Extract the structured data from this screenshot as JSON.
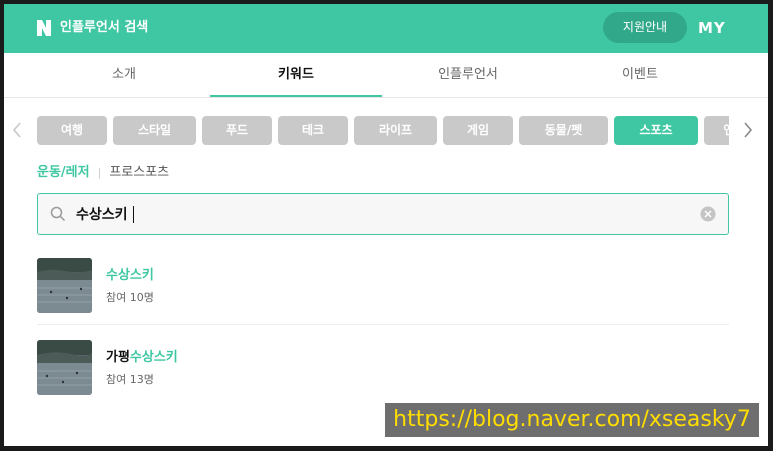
{
  "header": {
    "title": "인플루언서 검색",
    "support_label": "지원안내",
    "my_label": "MY",
    "brand_color": "#3fc7a3"
  },
  "tabs": [
    {
      "label": "소개",
      "active": false
    },
    {
      "label": "키워드",
      "active": true
    },
    {
      "label": "인플루언서",
      "active": false
    },
    {
      "label": "이벤트",
      "active": false
    }
  ],
  "categories": [
    {
      "label": "여행",
      "active": false
    },
    {
      "label": "스타일",
      "active": false
    },
    {
      "label": "푸드",
      "active": false
    },
    {
      "label": "테크",
      "active": false
    },
    {
      "label": "라이프",
      "active": false
    },
    {
      "label": "게임",
      "active": false
    },
    {
      "label": "동물/펫",
      "active": false
    },
    {
      "label": "스포츠",
      "active": true
    },
    {
      "label": "엔",
      "active": false
    }
  ],
  "subcategories": {
    "active": "운동/레저",
    "other": "프로스포츠"
  },
  "search": {
    "value": "수상스키",
    "icon": "search-icon",
    "clear_icon": "clear-icon"
  },
  "results": [
    {
      "title_prefix": "",
      "title_highlight": "수상스키",
      "participants": "참여 10명"
    },
    {
      "title_prefix": "가평",
      "title_highlight": "수상스키",
      "participants": "참여 13명"
    }
  ],
  "watermark": "https://blog.naver.com/xseasky7"
}
